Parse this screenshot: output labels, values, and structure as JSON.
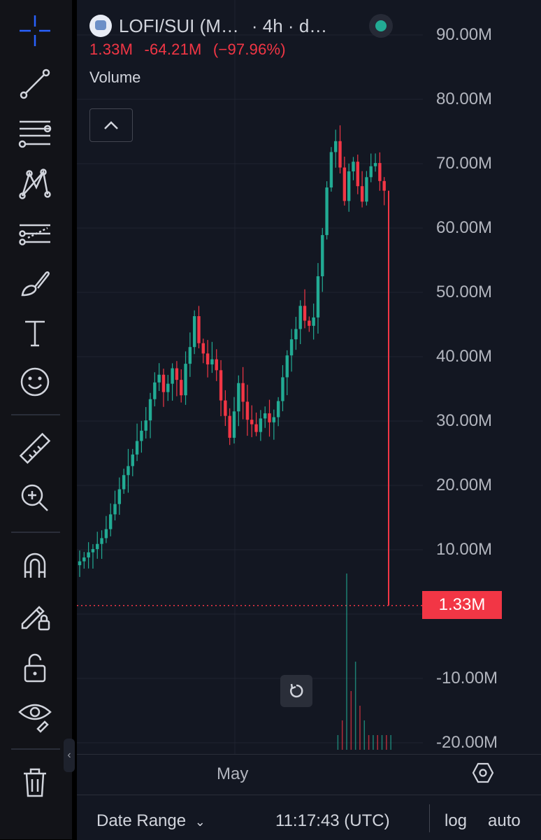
{
  "header": {
    "symbol": "LOFI/SUI (M…",
    "meta": "· 4h · d…",
    "last_value": "1.33M",
    "change": "-64.21M",
    "change_pct": "(−97.96%)",
    "indicator_label": "Volume"
  },
  "toolbar": {
    "tools": [
      "crosshair-icon",
      "trend-line-icon",
      "fib-retracement-icon",
      "pattern-icon",
      "forecast-icon",
      "brush-icon",
      "text-icon",
      "emoji-icon",
      "ruler-icon",
      "zoom-in-icon",
      "magnet-icon",
      "lock-drawing-icon",
      "unlock-icon",
      "eye-icon",
      "trash-icon"
    ]
  },
  "price_axis": {
    "labels": [
      "90.00M",
      "80.00M",
      "70.00M",
      "60.00M",
      "50.00M",
      "40.00M",
      "30.00M",
      "20.00M",
      "10.00M",
      "-10.00M",
      "-20.00M"
    ],
    "current_tag": "1.33M"
  },
  "time_axis": {
    "month_label": "May"
  },
  "bottom_bar": {
    "date_range": "Date Range",
    "clock": "11:17:43 (UTC)",
    "log": "log",
    "auto": "auto"
  },
  "colors": {
    "up": "#22ab94",
    "down": "#f23645",
    "background": "#131722",
    "grid": "#1f2330"
  },
  "chart_data": {
    "type": "candlestick",
    "ylim": [
      -22000000,
      95000000
    ],
    "closes": [
      8.2,
      8.8,
      9.6,
      10.1,
      10.9,
      11.8,
      13.2,
      15.5,
      17.1,
      19.4,
      21.6,
      23.0,
      24.8,
      26.9,
      28.5,
      30.1,
      33.4,
      36.0,
      37.2,
      34.5,
      35.8,
      38.2,
      36.4,
      34.0,
      38.9,
      41.5,
      46.3,
      42.1,
      40.5,
      38.8,
      39.6,
      37.9,
      33.2,
      30.8,
      27.4,
      31.5,
      35.9,
      33.0,
      30.2,
      29.5,
      28.3,
      30.4,
      31.2,
      29.8,
      30.6,
      33.1,
      36.8,
      40.2,
      42.7,
      44.3,
      47.9,
      45.6,
      44.8,
      46.1,
      52.5,
      58.9,
      66.3,
      71.8,
      73.5,
      69.4,
      64.2,
      68.8,
      70.3,
      66.5,
      64.1,
      67.9,
      69.6,
      70.1,
      67.3,
      65.8,
      1.33
    ],
    "volume_spikes": [
      0,
      0,
      0,
      0,
      0,
      0,
      0,
      0,
      0,
      0,
      0,
      0,
      0,
      0,
      0,
      0,
      0,
      0,
      0,
      0,
      0,
      0,
      0,
      0,
      0,
      0,
      0,
      0,
      0,
      0,
      0,
      0,
      0,
      0,
      0,
      0,
      0,
      0,
      0,
      0,
      0,
      0,
      0,
      0,
      0,
      0,
      0,
      0,
      0,
      0,
      0,
      0,
      0,
      0,
      0,
      0,
      0,
      0,
      1,
      2,
      12,
      4,
      6,
      3,
      2,
      1,
      1,
      1,
      1,
      1,
      1
    ]
  }
}
